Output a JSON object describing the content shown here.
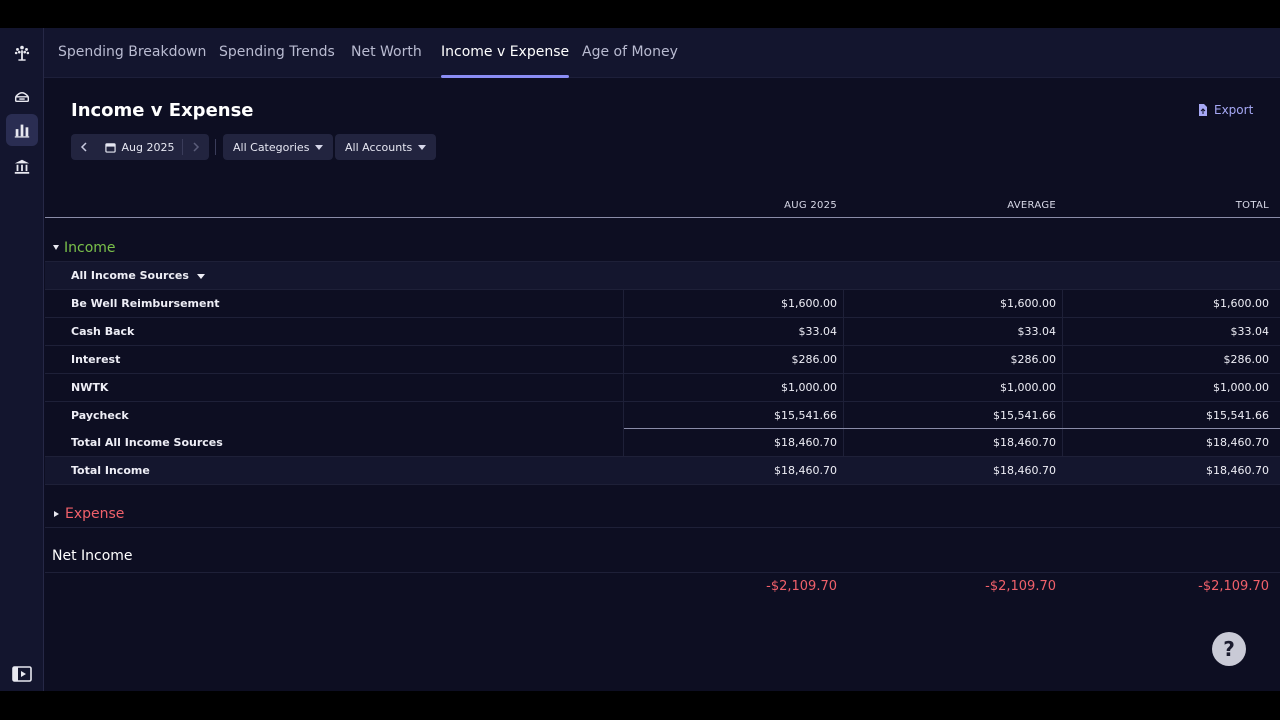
{
  "tabs": [
    {
      "label": "Spending Breakdown",
      "active": false
    },
    {
      "label": "Spending Trends",
      "active": false
    },
    {
      "label": "Net Worth",
      "active": false
    },
    {
      "label": "Income v Expense",
      "active": true
    },
    {
      "label": "Age of Money",
      "active": false
    }
  ],
  "page": {
    "title": "Income v Expense",
    "export_label": "Export"
  },
  "filters": {
    "date": "Aug 2025",
    "categories": "All Categories",
    "accounts": "All Accounts"
  },
  "table": {
    "columns": [
      "AUG 2025",
      "AVERAGE",
      "TOTAL"
    ],
    "income": {
      "label": "Income",
      "group_label": "All Income Sources",
      "rows": [
        {
          "name": "Be Well Reimbursement",
          "values": [
            "$1,600.00",
            "$1,600.00",
            "$1,600.00"
          ]
        },
        {
          "name": "Cash Back",
          "values": [
            "$33.04",
            "$33.04",
            "$33.04"
          ]
        },
        {
          "name": "Interest",
          "values": [
            "$286.00",
            "$286.00",
            "$286.00"
          ]
        },
        {
          "name": "NWTK",
          "values": [
            "$1,000.00",
            "$1,000.00",
            "$1,000.00"
          ]
        },
        {
          "name": "Paycheck",
          "values": [
            "$15,541.66",
            "$15,541.66",
            "$15,541.66"
          ]
        }
      ],
      "group_total": {
        "name": "Total All Income Sources",
        "values": [
          "$18,460.70",
          "$18,460.70",
          "$18,460.70"
        ]
      },
      "total": {
        "name": "Total Income",
        "values": [
          "$18,460.70",
          "$18,460.70",
          "$18,460.70"
        ]
      }
    },
    "expense": {
      "label": "Expense"
    },
    "net_income": {
      "label": "Net Income",
      "values": [
        "-$2,109.70",
        "-$2,109.70",
        "-$2,109.70"
      ]
    }
  },
  "help": {
    "label": "?"
  },
  "colors": {
    "accent": "#8b8df5",
    "income": "#7ac04a",
    "expense": "#f0606a",
    "background": "#0d0e22"
  }
}
